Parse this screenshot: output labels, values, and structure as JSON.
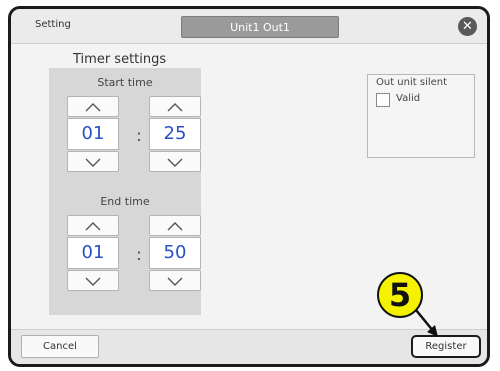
{
  "header": {
    "title": "Setting",
    "unit_tab": "Unit1 Out1",
    "close_icon": "close-icon"
  },
  "timer": {
    "title": "Timer settings",
    "start": {
      "label": "Start time",
      "hour": "01",
      "separator": ":",
      "minute": "25"
    },
    "end": {
      "label": "End time",
      "hour": "01",
      "separator": ":",
      "minute": "50"
    },
    "up_symbol": "^",
    "down_symbol": "v"
  },
  "out_unit_silent": {
    "title": "Out unit silent",
    "checkbox_label": "Valid",
    "checked": false
  },
  "footer": {
    "cancel_label": "Cancel",
    "register_label": "Register"
  },
  "callout": {
    "step_number": "5",
    "color": "#f5f200"
  }
}
